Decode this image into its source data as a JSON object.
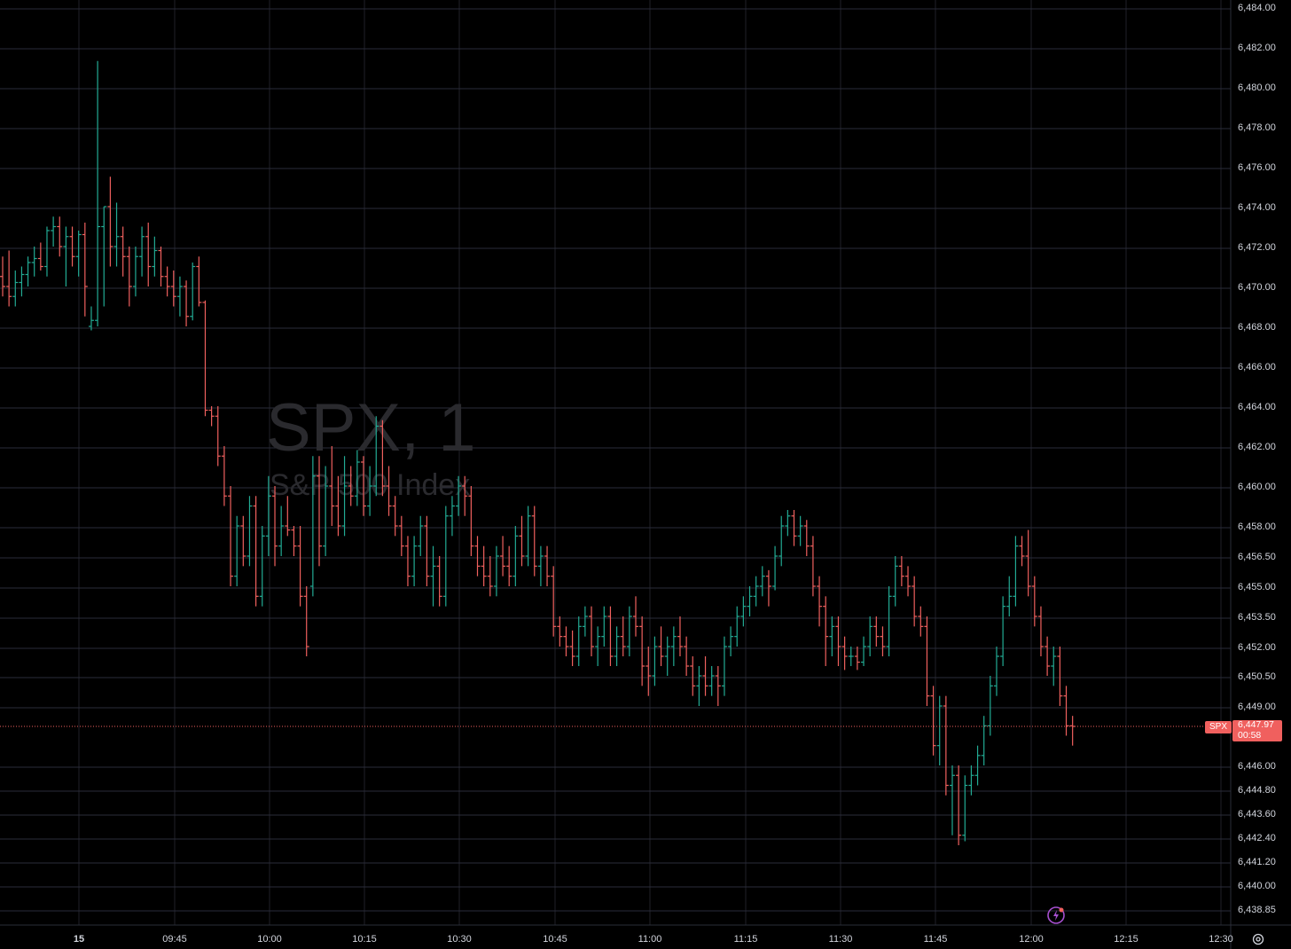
{
  "chart_data": {
    "type": "ohlc",
    "title": "SPX, 1",
    "subtitle": "S&P 500 Index",
    "symbol": "SPX",
    "last_price": "6,447.97",
    "countdown": "00:58",
    "up_color": "#22ab94",
    "down_color": "#f0605e",
    "ylim": [
      6438,
      6484.3
    ],
    "y_ticks": [
      "6,484.00",
      "6,482.00",
      "6,480.00",
      "6,478.00",
      "6,476.00",
      "6,474.00",
      "6,472.00",
      "6,470.00",
      "6,468.00",
      "6,466.00",
      "6,464.00",
      "6,462.00",
      "6,460.00",
      "6,458.00",
      "6,456.50",
      "6,455.00",
      "6,453.50",
      "6,452.00",
      "6,450.50",
      "6,449.00",
      "6,446.00",
      "6,444.80",
      "6,443.60",
      "6,442.40",
      "6,441.20",
      "6,440.00",
      "6,438.85"
    ],
    "x_ticks": [
      "15",
      "09:45",
      "10:00",
      "10:15",
      "10:30",
      "10:45",
      "11:00",
      "11:15",
      "11:30",
      "11:45",
      "12:00",
      "12:15",
      "12:30"
    ],
    "grid": true,
    "bars": [
      [
        6470.5,
        6471.5,
        6469.5,
        6470.0
      ],
      [
        6470.0,
        6471.8,
        6469.0,
        6469.5
      ],
      [
        6469.5,
        6470.8,
        6469.0,
        6470.2
      ],
      [
        6470.2,
        6471.0,
        6469.5,
        6470.6
      ],
      [
        6470.6,
        6471.5,
        6470.0,
        6471.2
      ],
      [
        6471.2,
        6472.0,
        6470.5,
        6471.4
      ],
      [
        6471.4,
        6472.2,
        6470.8,
        6471.0
      ],
      [
        6471.0,
        6473.0,
        6470.5,
        6472.8
      ],
      [
        6472.8,
        6473.5,
        6472.0,
        6473.0
      ],
      [
        6473.0,
        6473.5,
        6471.5,
        6472.0
      ],
      [
        6472.0,
        6473.0,
        6470.0,
        6472.5
      ],
      [
        6472.5,
        6473.0,
        6471.0,
        6471.5
      ],
      [
        6471.5,
        6472.8,
        6470.5,
        6472.6
      ],
      [
        6472.6,
        6473.2,
        6468.5,
        6470.0
      ],
      [
        6468.0,
        6469.0,
        6467.8,
        6468.3
      ],
      [
        6468.3,
        6481.3,
        6468.0,
        6473.0
      ],
      [
        6473.0,
        6474.0,
        6469.0,
        6474.0
      ],
      [
        6474.0,
        6475.5,
        6471.0,
        6472.0
      ],
      [
        6472.0,
        6474.2,
        6471.0,
        6472.5
      ],
      [
        6472.5,
        6473.0,
        6470.5,
        6471.5
      ],
      [
        6471.5,
        6472.0,
        6469.0,
        6470.0
      ],
      [
        6470.0,
        6472.0,
        6469.5,
        6471.5
      ],
      [
        6471.5,
        6473.0,
        6470.5,
        6472.5
      ],
      [
        6472.5,
        6473.2,
        6470.0,
        6471.0
      ],
      [
        6471.0,
        6472.5,
        6470.5,
        6471.8
      ],
      [
        6471.8,
        6472.0,
        6470.0,
        6470.5
      ],
      [
        6470.5,
        6471.0,
        6469.5,
        6470.0
      ],
      [
        6470.0,
        6470.8,
        6469.0,
        6469.5
      ],
      [
        6469.5,
        6470.5,
        6468.5,
        6470.0
      ],
      [
        6470.0,
        6470.3,
        6468.0,
        6468.5
      ],
      [
        6468.5,
        6471.2,
        6468.3,
        6471.0
      ],
      [
        6471.0,
        6471.5,
        6469.0,
        6469.2
      ],
      [
        6469.2,
        6469.3,
        6463.5,
        6463.8
      ],
      [
        6463.8,
        6464.0,
        6463.0,
        6463.5
      ],
      [
        6463.5,
        6464.0,
        6461.0,
        6461.5
      ],
      [
        6461.5,
        6462.0,
        6459.0,
        6459.5
      ],
      [
        6459.5,
        6460.0,
        6455.0,
        6455.5
      ],
      [
        6455.5,
        6458.5,
        6455.0,
        6458.0
      ],
      [
        6458.0,
        6458.5,
        6456.0,
        6456.5
      ],
      [
        6456.5,
        6459.5,
        6456.0,
        6459.0
      ],
      [
        6459.0,
        6459.5,
        6454.0,
        6454.5
      ],
      [
        6454.5,
        6458.0,
        6454.0,
        6457.5
      ],
      [
        6457.5,
        6460.5,
        6456.5,
        6459.5
      ],
      [
        6459.5,
        6460.0,
        6456.0,
        6457.0
      ],
      [
        6457.0,
        6459.0,
        6456.5,
        6458.0
      ],
      [
        6458.0,
        6459.5,
        6457.5,
        6457.8
      ],
      [
        6457.8,
        6458.0,
        6456.5,
        6457.0
      ],
      [
        6457.0,
        6458.0,
        6454.0,
        6454.5
      ],
      [
        6454.5,
        6455.0,
        6451.5,
        6452.0
      ],
      [
        6455.0,
        6461.5,
        6454.5,
        6460.5
      ],
      [
        6460.5,
        6461.5,
        6456.0,
        6457.0
      ],
      [
        6457.0,
        6461.0,
        6456.5,
        6460.0
      ],
      [
        6460.0,
        6462.0,
        6458.0,
        6459.0
      ],
      [
        6459.0,
        6460.5,
        6457.5,
        6458.0
      ],
      [
        6458.0,
        6461.5,
        6457.5,
        6460.0
      ],
      [
        6460.0,
        6461.0,
        6459.0,
        6459.5
      ],
      [
        6459.5,
        6461.8,
        6459.0,
        6461.2
      ],
      [
        6461.2,
        6461.5,
        6458.5,
        6459.0
      ],
      [
        6459.0,
        6461.0,
        6458.5,
        6460.0
      ],
      [
        6460.0,
        6463.5,
        6459.5,
        6463.0
      ],
      [
        6463.0,
        6463.3,
        6459.5,
        6460.0
      ],
      [
        6460.0,
        6461.0,
        6458.5,
        6459.0
      ],
      [
        6459.0,
        6459.5,
        6457.5,
        6458.0
      ],
      [
        6458.0,
        6458.5,
        6456.5,
        6457.0
      ],
      [
        6457.0,
        6457.5,
        6455.0,
        6455.5
      ],
      [
        6455.5,
        6457.5,
        6455.0,
        6457.0
      ],
      [
        6457.0,
        6458.5,
        6456.5,
        6458.0
      ],
      [
        6458.0,
        6458.5,
        6455.0,
        6455.5
      ],
      [
        6455.5,
        6457.0,
        6454.0,
        6456.0
      ],
      [
        6456.0,
        6456.5,
        6454.0,
        6454.5
      ],
      [
        6454.5,
        6459.0,
        6454.0,
        6458.5
      ],
      [
        6458.5,
        6459.5,
        6457.5,
        6459.0
      ],
      [
        6459.0,
        6460.5,
        6458.5,
        6460.0
      ],
      [
        6460.0,
        6460.5,
        6458.5,
        6459.5
      ],
      [
        6459.5,
        6460.0,
        6456.5,
        6457.0
      ],
      [
        6457.0,
        6457.5,
        6455.5,
        6456.0
      ],
      [
        6456.0,
        6457.0,
        6455.0,
        6455.5
      ],
      [
        6455.5,
        6456.5,
        6454.5,
        6455.0
      ],
      [
        6455.0,
        6457.0,
        6454.5,
        6456.5
      ],
      [
        6456.5,
        6457.5,
        6455.5,
        6456.0
      ],
      [
        6456.0,
        6457.0,
        6455.0,
        6455.5
      ],
      [
        6455.5,
        6458.0,
        6455.0,
        6457.5
      ],
      [
        6457.5,
        6458.5,
        6456.0,
        6456.5
      ],
      [
        6456.5,
        6459.0,
        6456.0,
        6458.5
      ],
      [
        6458.5,
        6459.0,
        6455.5,
        6456.0
      ],
      [
        6456.0,
        6457.0,
        6455.0,
        6456.5
      ],
      [
        6456.5,
        6457.0,
        6455.0,
        6455.5
      ],
      [
        6455.5,
        6456.0,
        6452.5,
        6453.0
      ],
      [
        6453.0,
        6453.5,
        6452.0,
        6452.5
      ],
      [
        6452.5,
        6453.0,
        6451.5,
        6452.0
      ],
      [
        6452.0,
        6452.8,
        6451.0,
        6451.5
      ],
      [
        6451.5,
        6453.5,
        6451.0,
        6453.0
      ],
      [
        6453.0,
        6454.0,
        6452.5,
        6453.5
      ],
      [
        6453.5,
        6454.0,
        6451.5,
        6452.0
      ],
      [
        6452.0,
        6453.0,
        6451.0,
        6452.5
      ],
      [
        6452.5,
        6454.0,
        6452.0,
        6453.5
      ],
      [
        6453.5,
        6454.0,
        6451.0,
        6451.5
      ],
      [
        6451.5,
        6453.0,
        6451.0,
        6452.5
      ],
      [
        6452.5,
        6453.5,
        6451.5,
        6452.0
      ],
      [
        6452.0,
        6454.0,
        6451.5,
        6453.5
      ],
      [
        6453.5,
        6454.5,
        6452.5,
        6453.0
      ],
      [
        6453.0,
        6453.5,
        6450.0,
        6451.0
      ],
      [
        6451.0,
        6452.0,
        6449.5,
        6450.5
      ],
      [
        6450.5,
        6452.5,
        6450.0,
        6452.0
      ],
      [
        6452.0,
        6453.0,
        6451.0,
        6451.5
      ],
      [
        6451.5,
        6452.5,
        6450.5,
        6452.0
      ],
      [
        6452.0,
        6453.0,
        6451.0,
        6452.5
      ],
      [
        6452.5,
        6453.5,
        6451.5,
        6452.0
      ],
      [
        6452.0,
        6452.5,
        6450.5,
        6451.0
      ],
      [
        6451.0,
        6451.5,
        6449.5,
        6450.0
      ],
      [
        6450.0,
        6451.0,
        6449.0,
        6450.5
      ],
      [
        6450.5,
        6451.5,
        6449.5,
        6450.0
      ],
      [
        6450.0,
        6451.0,
        6449.5,
        6450.5
      ],
      [
        6450.5,
        6451.0,
        6449.0,
        6450.0
      ],
      [
        6450.0,
        6452.5,
        6449.5,
        6452.0
      ],
      [
        6452.0,
        6453.0,
        6451.5,
        6452.5
      ],
      [
        6452.5,
        6454.0,
        6452.0,
        6453.5
      ],
      [
        6453.5,
        6454.5,
        6453.0,
        6454.0
      ],
      [
        6454.0,
        6455.0,
        6453.5,
        6454.5
      ],
      [
        6454.5,
        6455.5,
        6454.0,
        6455.0
      ],
      [
        6455.0,
        6456.0,
        6454.5,
        6455.5
      ],
      [
        6455.5,
        6455.8,
        6454.0,
        6455.0
      ],
      [
        6455.0,
        6457.0,
        6454.8,
        6456.5
      ],
      [
        6456.5,
        6458.5,
        6456.0,
        6458.0
      ],
      [
        6458.0,
        6458.8,
        6457.5,
        6458.5
      ],
      [
        6458.5,
        6458.8,
        6457.0,
        6457.5
      ],
      [
        6457.5,
        6458.5,
        6457.0,
        6458.0
      ],
      [
        6458.0,
        6458.3,
        6456.5,
        6457.0
      ],
      [
        6457.0,
        6457.5,
        6454.5,
        6455.0
      ],
      [
        6455.0,
        6455.5,
        6453.0,
        6454.0
      ],
      [
        6454.0,
        6454.5,
        6451.0,
        6452.5
      ],
      [
        6452.5,
        6453.5,
        6451.5,
        6453.0
      ],
      [
        6453.0,
        6453.5,
        6451.0,
        6452.0
      ],
      [
        6452.0,
        6452.5,
        6450.8,
        6451.5
      ],
      [
        6451.5,
        6452.0,
        6451.0,
        6451.5
      ],
      [
        6451.5,
        6452.0,
        6450.8,
        6451.2
      ],
      [
        6451.2,
        6452.5,
        6451.0,
        6452.0
      ],
      [
        6452.0,
        6453.5,
        6451.5,
        6453.0
      ],
      [
        6453.0,
        6453.5,
        6452.0,
        6452.5
      ],
      [
        6452.5,
        6453.0,
        6451.5,
        6452.0
      ],
      [
        6452.0,
        6455.0,
        6451.5,
        6454.5
      ],
      [
        6454.5,
        6456.5,
        6454.0,
        6456.0
      ],
      [
        6456.0,
        6456.5,
        6455.0,
        6455.5
      ],
      [
        6455.5,
        6456.0,
        6454.5,
        6455.0
      ],
      [
        6455.0,
        6455.5,
        6453.0,
        6453.5
      ],
      [
        6453.5,
        6454.0,
        6452.5,
        6453.0
      ],
      [
        6453.0,
        6453.5,
        6449.0,
        6449.5
      ],
      [
        6449.5,
        6450.0,
        6446.5,
        6447.0
      ],
      [
        6447.0,
        6449.5,
        6446.0,
        6449.0
      ],
      [
        6449.0,
        6449.5,
        6444.5,
        6445.0
      ],
      [
        6445.0,
        6446.0,
        6442.5,
        6445.5
      ],
      [
        6445.5,
        6446.0,
        6442.0,
        6442.5
      ],
      [
        6442.5,
        6445.5,
        6442.2,
        6445.0
      ],
      [
        6445.0,
        6446.0,
        6444.5,
        6445.5
      ],
      [
        6445.5,
        6447.0,
        6445.0,
        6446.5
      ],
      [
        6446.5,
        6448.5,
        6446.0,
        6448.0
      ],
      [
        6448.0,
        6450.5,
        6447.5,
        6450.0
      ],
      [
        6450.0,
        6452.0,
        6449.5,
        6451.5
      ],
      [
        6451.5,
        6454.5,
        6451.0,
        6454.0
      ],
      [
        6454.0,
        6455.5,
        6453.5,
        6454.5
      ],
      [
        6454.5,
        6457.5,
        6454.0,
        6457.0
      ],
      [
        6457.0,
        6457.5,
        6456.0,
        6456.5
      ],
      [
        6456.5,
        6457.8,
        6454.5,
        6455.0
      ],
      [
        6455.0,
        6455.5,
        6453.0,
        6453.5
      ],
      [
        6453.5,
        6454.0,
        6451.5,
        6452.0
      ],
      [
        6452.0,
        6452.5,
        6450.5,
        6451.0
      ],
      [
        6451.0,
        6452.0,
        6450.0,
        6451.5
      ],
      [
        6451.5,
        6452.0,
        6449.0,
        6449.5
      ],
      [
        6449.5,
        6450.0,
        6447.5,
        6448.0
      ],
      [
        6448.0,
        6448.5,
        6447.0,
        6447.97
      ]
    ]
  },
  "ui": {
    "symbol_badge": "SPX",
    "settings_icon": "gear-icon",
    "quick_action_icon": "lightning-icon"
  }
}
